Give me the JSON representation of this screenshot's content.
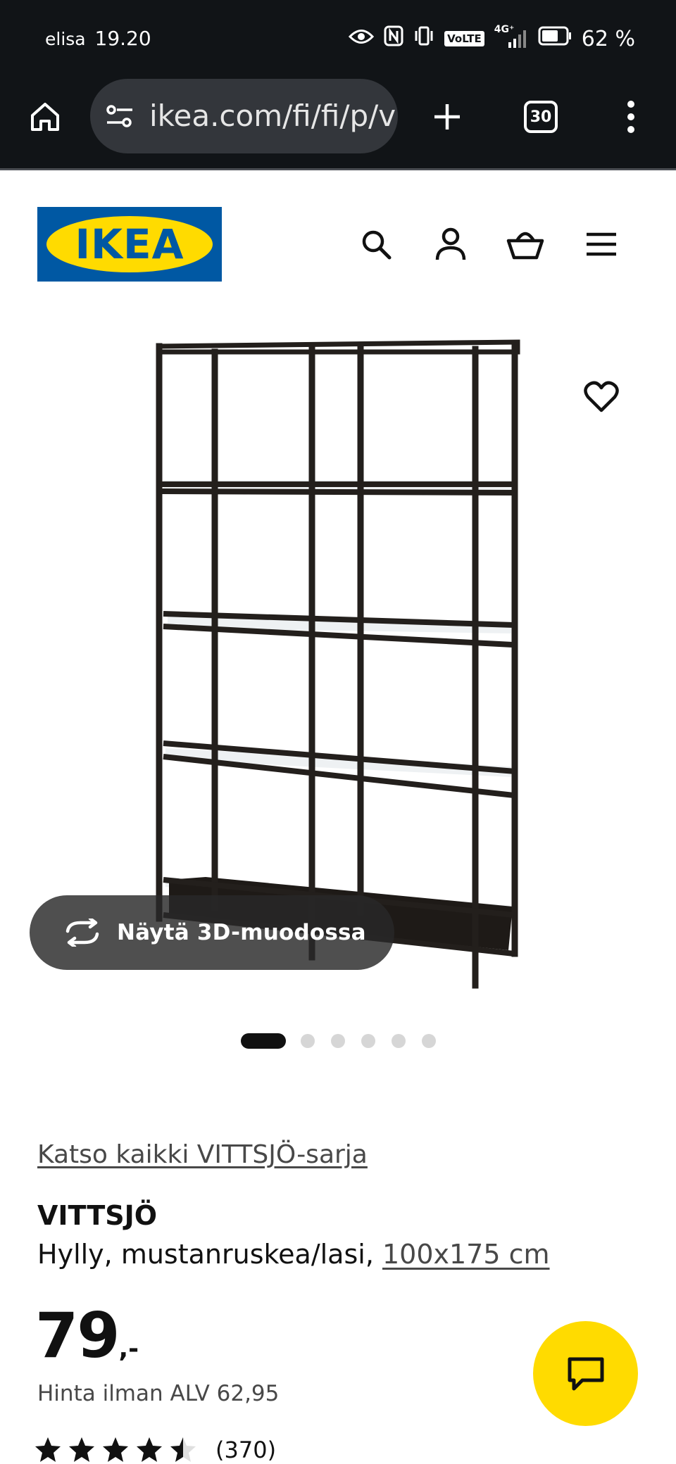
{
  "status_bar": {
    "carrier": "elisa",
    "time": "19.20",
    "network": "4G⁺",
    "volte": "VoLTE",
    "battery": "62 %"
  },
  "browser": {
    "url": "ikea.com/fi/fi/p/vi",
    "tab_count": "30",
    "icons": [
      "home-icon",
      "site-settings-icon",
      "new-tab-icon",
      "tab-switcher-icon",
      "more-menu-icon"
    ]
  },
  "site": {
    "logo_text": "IKEA",
    "header_icons": [
      "search-icon",
      "account-icon",
      "basket-icon",
      "menu-icon"
    ]
  },
  "hero": {
    "view_3d_label": "Näytä 3D-muodossa",
    "carousel_total": 6,
    "carousel_active": 1
  },
  "product": {
    "series_link": "Katso kaikki VITTSJÖ-sarja",
    "name": "VITTSJÖ",
    "description": "Hylly, mustanruskea/lasi, ",
    "size": "100x175 cm",
    "price_integer": "79",
    "price_decimals": ",-",
    "price_ex_vat": "Hinta ilman ALV 62,95",
    "rating_value": 4.5,
    "rating_max": 5,
    "review_count": "(370)"
  },
  "colors": {
    "ikea_blue": "#0058a3",
    "ikea_yellow": "#ffdb00",
    "browser_dark": "#111417"
  }
}
